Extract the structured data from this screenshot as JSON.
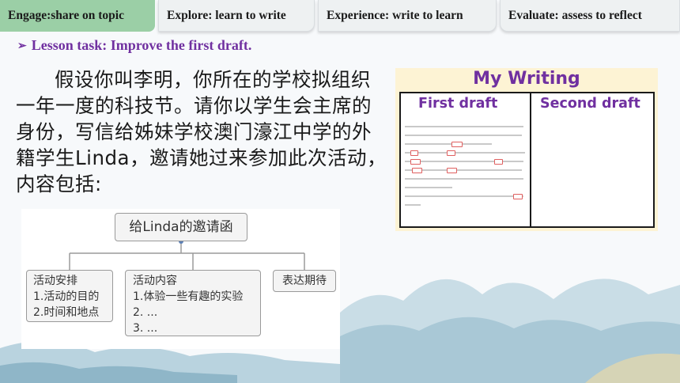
{
  "tabs": [
    {
      "label": "Engage:share on topic"
    },
    {
      "label": "Explore: learn to write"
    },
    {
      "label": "Experience: write to learn"
    },
    {
      "label": "Evaluate: assess to reflect"
    }
  ],
  "task": {
    "label": "Lesson task: Improve the first draft."
  },
  "prompt": {
    "text": "假设你叫李明，你所在的学校拟组织一年一度的科技节。请你以学生会主席的身份，写信给姊妹学校澳门濠江中学的外籍学生Linda，邀请她过来参加此次活动，内容包括:"
  },
  "mindmap": {
    "root": "给Linda的邀请函",
    "branches": [
      {
        "title": "活动安排",
        "items": [
          "1.活动的目的",
          "2.时间和地点"
        ]
      },
      {
        "title": "活动内容",
        "items": [
          "1.体验一些有趣的实验",
          "2. ...",
          "3. ..."
        ]
      },
      {
        "title": "表达期待",
        "items": []
      }
    ]
  },
  "writing": {
    "title": "My Writing",
    "col1": "First draft",
    "col2": "Second draft"
  },
  "colors": {
    "accent": "#7030a0",
    "engage_tab": "#9bcfa6"
  }
}
